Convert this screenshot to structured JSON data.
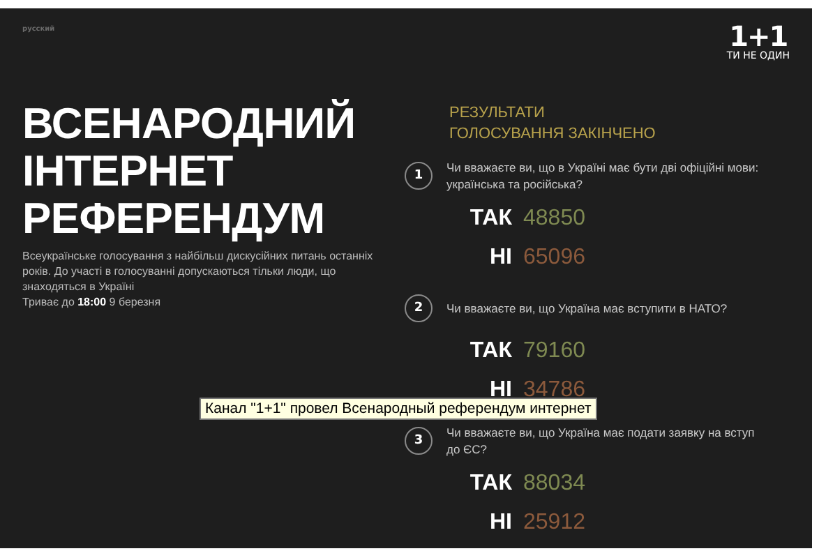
{
  "language_link": "русский",
  "logo": {
    "mark": "1+1",
    "slogan": "ТИ НЕ ОДИН"
  },
  "title_lines": [
    "ВСЕНАРОДНИЙ",
    "ІНТЕРНЕТ",
    "РЕФЕРЕНДУМ"
  ],
  "description": "Всеукраїнське голосування з найбільш дискусійних питань останніх років. До участі в голосуванні допускаються тільки люди, що знаходяться в Україні",
  "deadline": "Триває до **18:00** 9 березня",
  "results_heading": [
    "РЕЗУЛЬТАТИ",
    "ГОЛОСУВАННЯ ЗАКІНЧЕНО"
  ],
  "questions": [
    {
      "number": "1",
      "text": "Чи вважаєте ви, що в Україні має бути дві офіційні мови: українська та російська?",
      "answers": [
        {
          "kind": "yes",
          "label": "ТАК",
          "count": "48850"
        },
        {
          "kind": "no",
          "label": "НІ",
          "count": "65096"
        }
      ]
    },
    {
      "number": "2",
      "text": "Чи вважаєте ви, що Україна має вступити в НАТО?",
      "answers": [
        {
          "kind": "yes",
          "label": "ТАК",
          "count": "79160"
        },
        {
          "kind": "no",
          "label": "НІ",
          "count": "34786"
        }
      ]
    },
    {
      "number": "3",
      "text": "Чи вважаєте ви, що Україна має подати заявку на вступ до ЄС?",
      "answers": [
        {
          "kind": "yes",
          "label": "ТАК",
          "count": "88034"
        },
        {
          "kind": "no",
          "label": "НІ",
          "count": "25912"
        }
      ]
    }
  ],
  "tooltip": "Канал \"1+1\" провел Всенародный референдум интернет"
}
